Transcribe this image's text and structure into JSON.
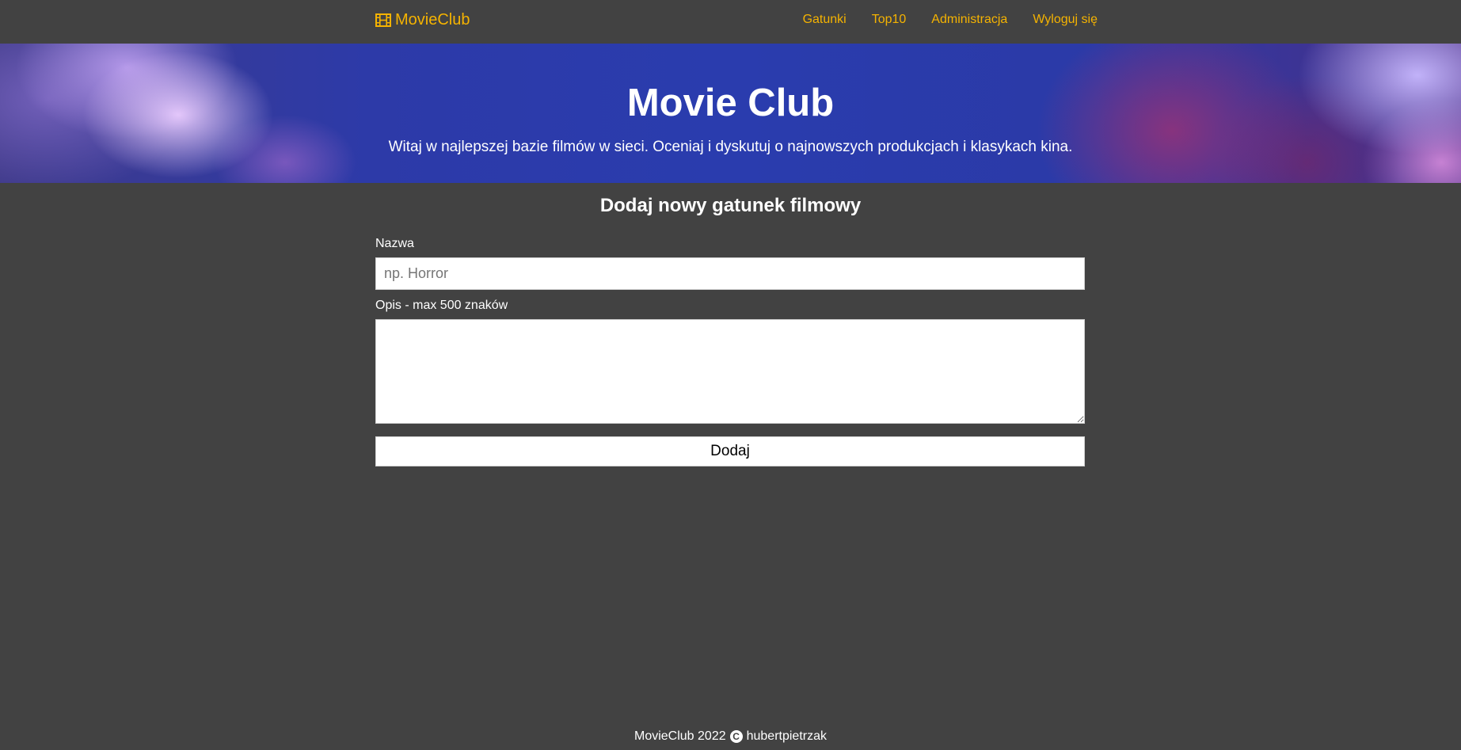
{
  "navbar": {
    "brand": "MovieClub",
    "brand_icon": "film-icon",
    "links": [
      "Gatunki",
      "Top10",
      "Administracja",
      "Wyloguj się"
    ]
  },
  "hero": {
    "title": "Movie Club",
    "subtitle": "Witaj w najlepszej bazie filmów w sieci. Oceniaj i dyskutuj o najnowszych produkcjach i klasykach kina."
  },
  "form": {
    "title": "Dodaj nowy gatunek filmowy",
    "name_label": "Nazwa",
    "name_placeholder": "np. Horror",
    "name_value": "",
    "description_label": "Opis - max 500 znaków",
    "description_value": "",
    "submit_label": "Dodaj"
  },
  "footer": {
    "text_before": "MovieClub 2022",
    "icon": "copyright-icon",
    "author": "hubertpietrzak"
  },
  "colors": {
    "background": "#424242",
    "accent": "#f5b301",
    "text": "#ffffff"
  }
}
